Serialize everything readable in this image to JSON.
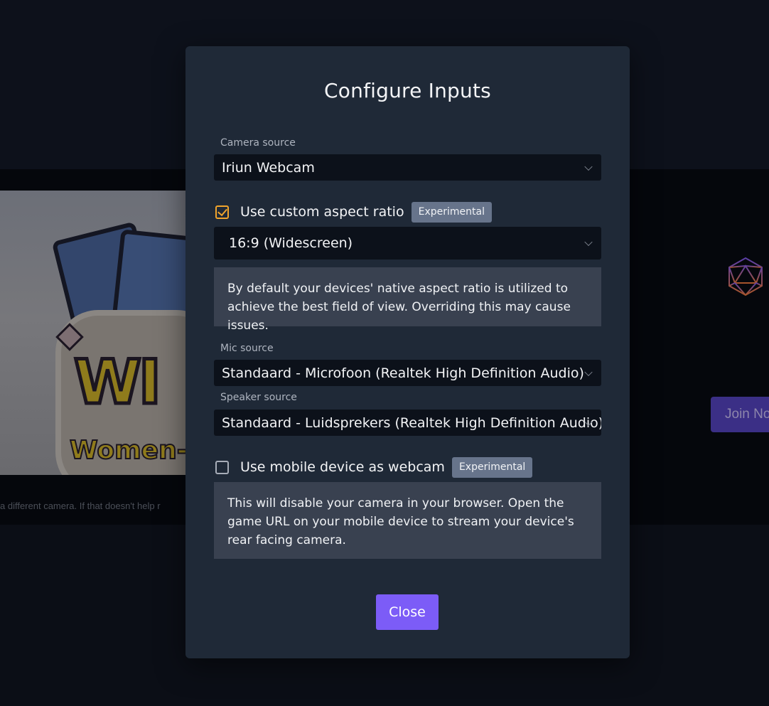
{
  "background": {
    "video_sticker_letters": "WI",
    "video_sticker_text": "Women-",
    "hint_text": "a different camera. If that doesn't help r",
    "join_button_label": "Join No"
  },
  "modal": {
    "title": "Configure Inputs",
    "camera": {
      "label": "Camera source",
      "value": "Iriun Webcam"
    },
    "aspect_ratio": {
      "checkbox_label": "Use custom aspect ratio",
      "checked": true,
      "badge": "Experimental",
      "value": "16:9 (Widescreen)",
      "info": "By default your devices' native aspect ratio is utilized to achieve the best field of view. Overriding this may cause issues."
    },
    "mic": {
      "label": "Mic source",
      "value": "Standaard - Microfoon (Realtek High Definition Audio)"
    },
    "speaker": {
      "label": "Speaker source",
      "value": "Standaard - Luidsprekers (Realtek High Definition Audio)"
    },
    "mobile_webcam": {
      "checkbox_label": "Use mobile device as webcam",
      "checked": false,
      "badge": "Experimental",
      "info": "This will disable your camera in your browser. Open the game URL on your mobile device to stream your device's rear facing camera."
    },
    "close_label": "Close"
  },
  "colors": {
    "accent": "#7c5cf7",
    "checkbox_checked": "#f0a42c",
    "modal_bg": "#1f2937",
    "select_bg": "#0c111a",
    "info_bg": "#394150",
    "badge_bg": "#67748b"
  }
}
